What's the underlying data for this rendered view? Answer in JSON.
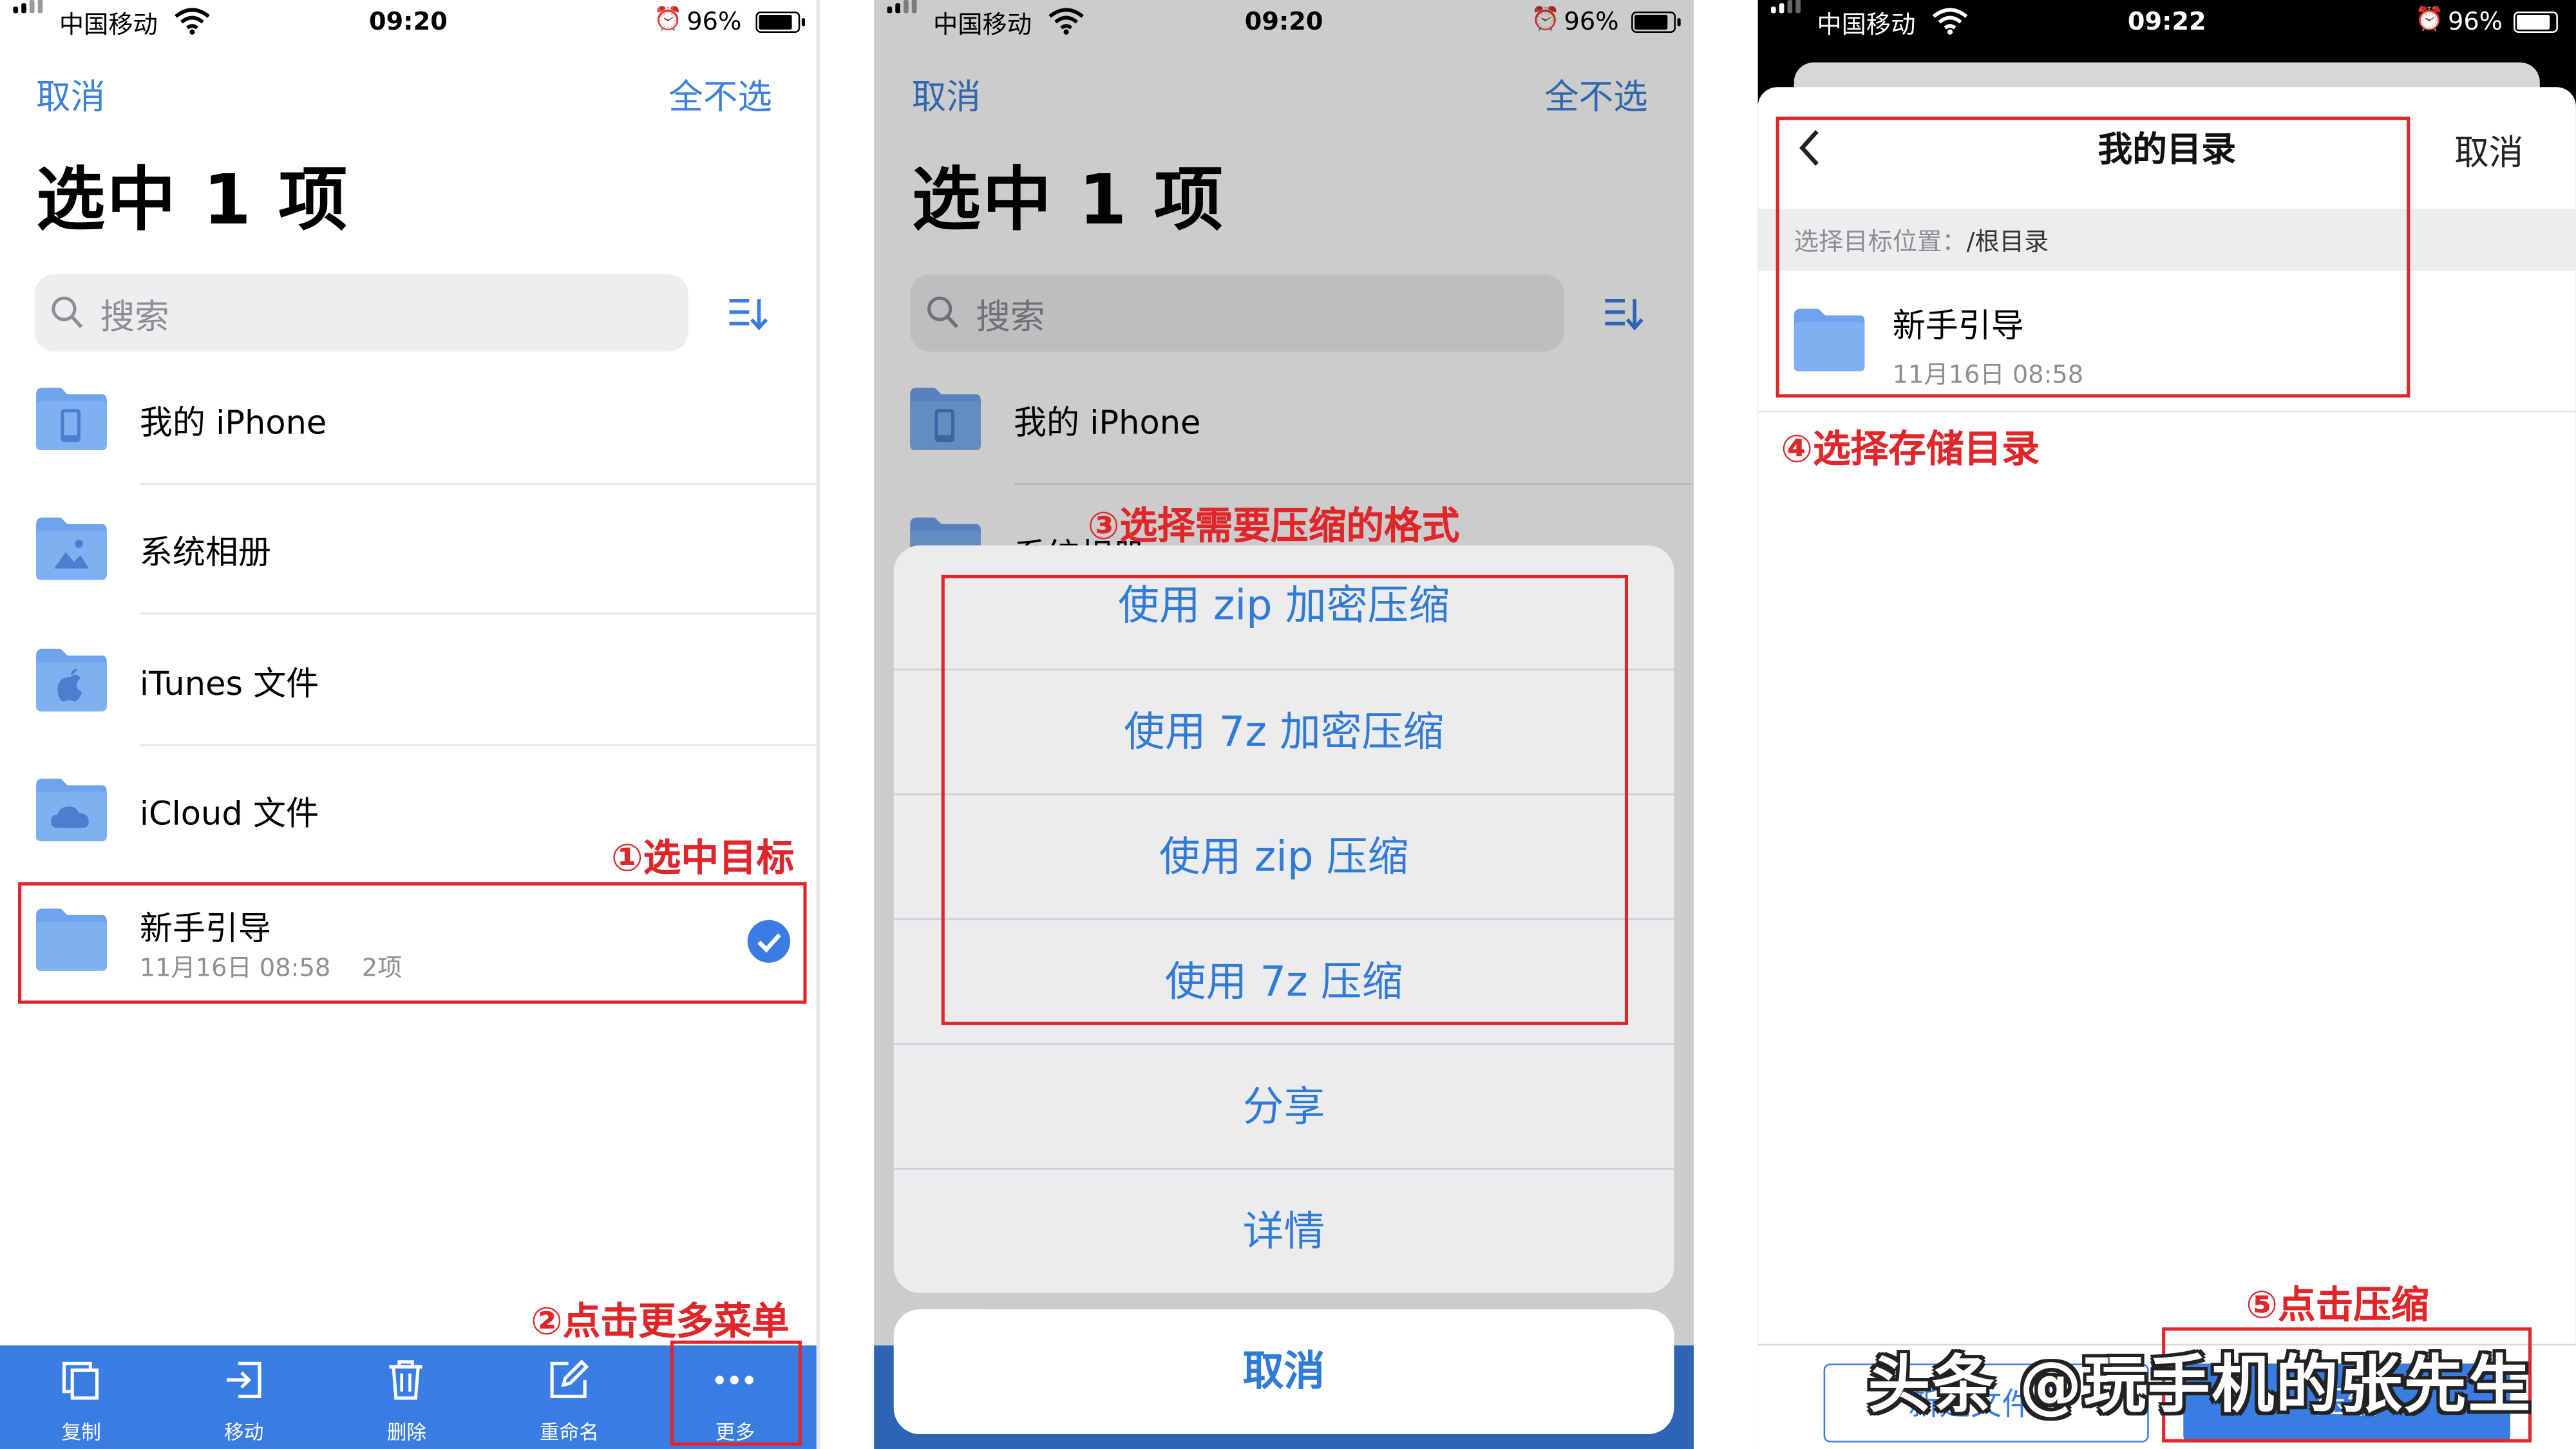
{
  "panel1": {
    "status": {
      "carrier": "中国移动",
      "time": "09:20",
      "battery": "96%"
    },
    "nav": {
      "cancel": "取消",
      "deselect_all": "全不选"
    },
    "title": "选中 1 项",
    "search_placeholder": "搜索",
    "items": [
      {
        "name": "我的 iPhone",
        "icon": "phone-folder-icon"
      },
      {
        "name": "系统相册",
        "icon": "photos-folder-icon"
      },
      {
        "name": "iTunes 文件",
        "icon": "apple-folder-icon"
      },
      {
        "name": "iCloud 文件",
        "icon": "cloud-folder-icon"
      },
      {
        "name": "新手引导",
        "meta": "11月16日 08:58    2项",
        "selected": true,
        "icon": "folder-icon"
      }
    ],
    "annotations": {
      "select_target": "①选中目标",
      "tap_more": "②点击更多菜单"
    },
    "tabbar": [
      {
        "label": "复制",
        "icon": "copy-icon"
      },
      {
        "label": "移动",
        "icon": "move-icon"
      },
      {
        "label": "删除",
        "icon": "trash-icon"
      },
      {
        "label": "重命名",
        "icon": "rename-icon"
      },
      {
        "label": "更多",
        "icon": "more-icon"
      }
    ]
  },
  "panel2": {
    "status": {
      "carrier": "中国移动",
      "time": "09:20",
      "battery": "96%"
    },
    "nav": {
      "cancel": "取消",
      "deselect_all": "全不选"
    },
    "title": "选中 1 项",
    "search_placeholder": "搜索",
    "items": [
      {
        "name": "我的 iPhone"
      },
      {
        "name": "系统相册"
      }
    ],
    "annotation": "③选择需要压缩的格式",
    "actions": [
      "使用 zip 加密压缩",
      "使用 7z 加密压缩",
      "使用 zip 压缩",
      "使用 7z 压缩",
      "分享",
      "详情"
    ],
    "cancel": "取消"
  },
  "panel3": {
    "status": {
      "carrier": "中国移动",
      "time": "09:22",
      "battery": "96%"
    },
    "title": "我的目录",
    "cancel": "取消",
    "path_label": "选择目标位置：",
    "path_value": "/根目录",
    "folder": {
      "name": "新手引导",
      "date": "11月16日 08:58"
    },
    "annotations": {
      "choose_dir": "④选择存储目录",
      "tap_compress": "⑤点击压缩"
    },
    "buttons": {
      "new_folder": "新建文件夹",
      "compress": "压缩"
    }
  },
  "watermark": "头条 @玩手机的张先生",
  "colors": {
    "accent": "#3a7de2",
    "annotation_red": "#e0262a",
    "folder_blue": "#6fa3ee"
  }
}
